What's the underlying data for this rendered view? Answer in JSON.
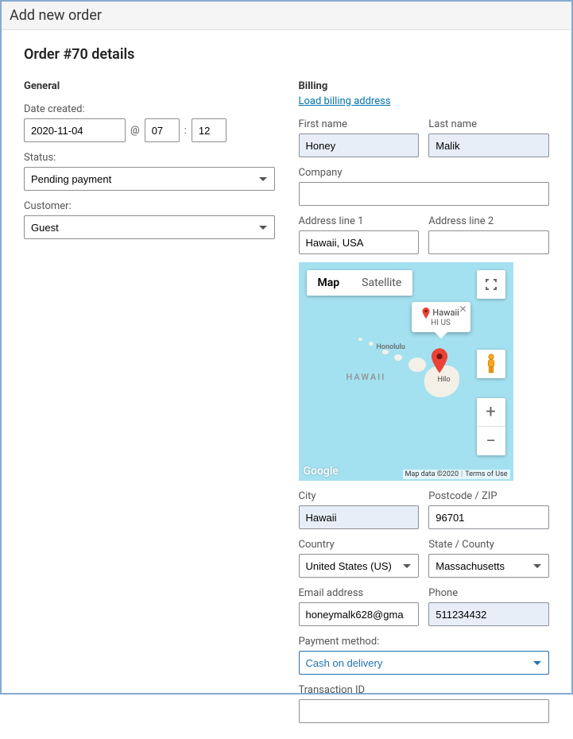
{
  "window": {
    "title": "Add new order"
  },
  "page": {
    "heading": "Order #70 details"
  },
  "general": {
    "heading": "General",
    "date_label": "Date created:",
    "date": "2020-11-04",
    "at": "@",
    "hour": "07",
    "colon": ":",
    "minute": "12",
    "status_label": "Status:",
    "status_value": "Pending payment",
    "customer_label": "Customer:",
    "customer_value": "Guest"
  },
  "billing": {
    "heading": "Billing",
    "load_link": "Load billing address",
    "first_name_label": "First name",
    "first_name": "Honey",
    "last_name_label": "Last name",
    "last_name": "Malik",
    "company_label": "Company",
    "company": "",
    "address1_label": "Address line 1",
    "address1": "Hawaii, USA",
    "address2_label": "Address line 2",
    "address2": "",
    "city_label": "City",
    "city": "Hawaii",
    "postcode_label": "Postcode / ZIP",
    "postcode": "96701",
    "country_label": "Country",
    "country_value": "United States (US)",
    "state_label": "State / County",
    "state_value": "Massachusetts",
    "email_label": "Email address",
    "email": "honeymalk628@gma",
    "phone_label": "Phone",
    "phone": "511234432",
    "payment_label": "Payment method:",
    "payment_value": "Cash on delivery",
    "txn_label": "Transaction ID",
    "txn": ""
  },
  "map": {
    "tab_map": "Map",
    "tab_satellite": "Satellite",
    "info_title": "Hawaii",
    "info_sub": "HI US",
    "label_state": "HAWAII",
    "label_honolulu": "Honolulu",
    "label_hilo": "Hilo",
    "logo": "Google",
    "credits_data": "Map data ©2020",
    "credits_terms": "Terms of Use"
  }
}
